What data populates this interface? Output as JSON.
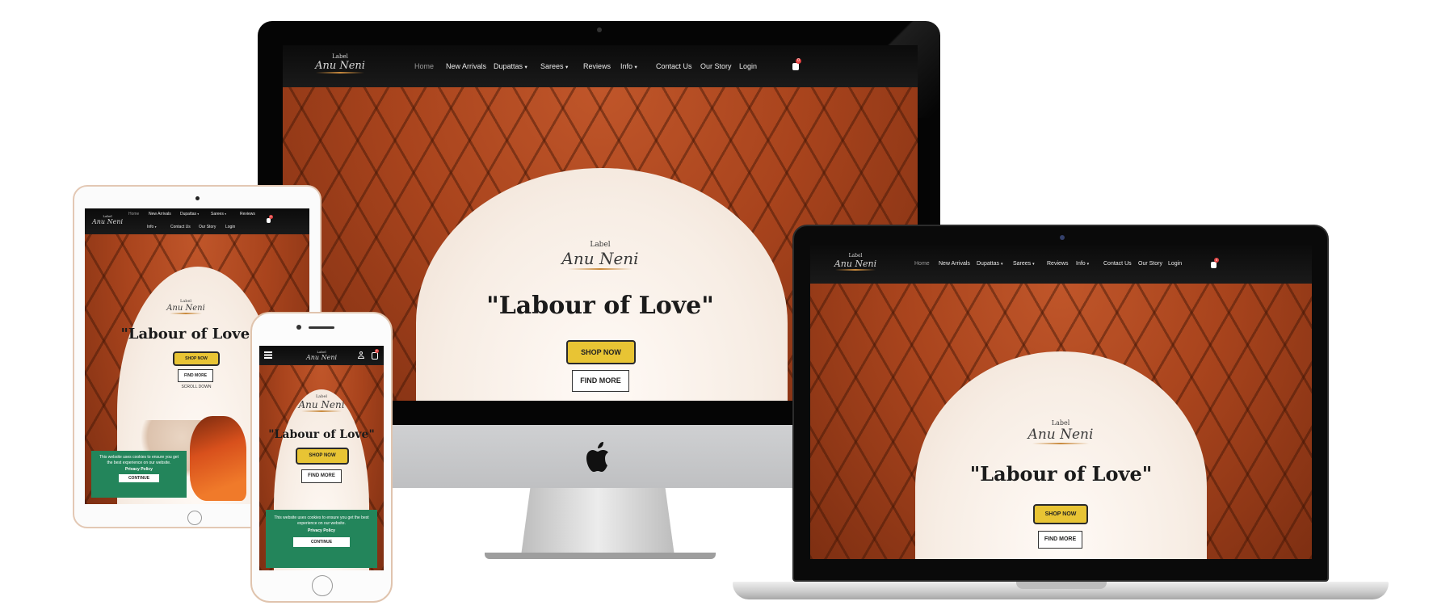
{
  "brand": {
    "logo_label": "Label",
    "logo_name": "Anu Neni"
  },
  "nav": {
    "home": "Home",
    "new_arrivals": "New Arrivals",
    "dupattas": "Dupattas",
    "sarees": "Sarees",
    "reviews": "Reviews",
    "info": "Info",
    "contact_us": "Contact Us",
    "our_story": "Our Story",
    "login": "Login",
    "cart_count": "0",
    "dropdown_glyph": "▾"
  },
  "hero": {
    "title": "\"Labour of Love\"",
    "shop_now": "SHOP NOW",
    "find_more": "FIND MORE",
    "scroll_down": "SCROLL DOWN"
  },
  "cookie": {
    "message": "This website uses cookies to ensure you get the best experience on our website.",
    "policy_link": "Privacy Policy",
    "continue": "CONTINUE"
  },
  "icons": {
    "menu": "list-menu-icon",
    "user": "user-icon",
    "cart": "cart-icon",
    "apple": "apple-logo-icon"
  },
  "colors": {
    "accent_yellow": "#e8c434",
    "cookie_green": "#23855b",
    "nav_dark": "#111111",
    "badge_red": "#e24343",
    "swash_gold": "#c98a3d"
  }
}
